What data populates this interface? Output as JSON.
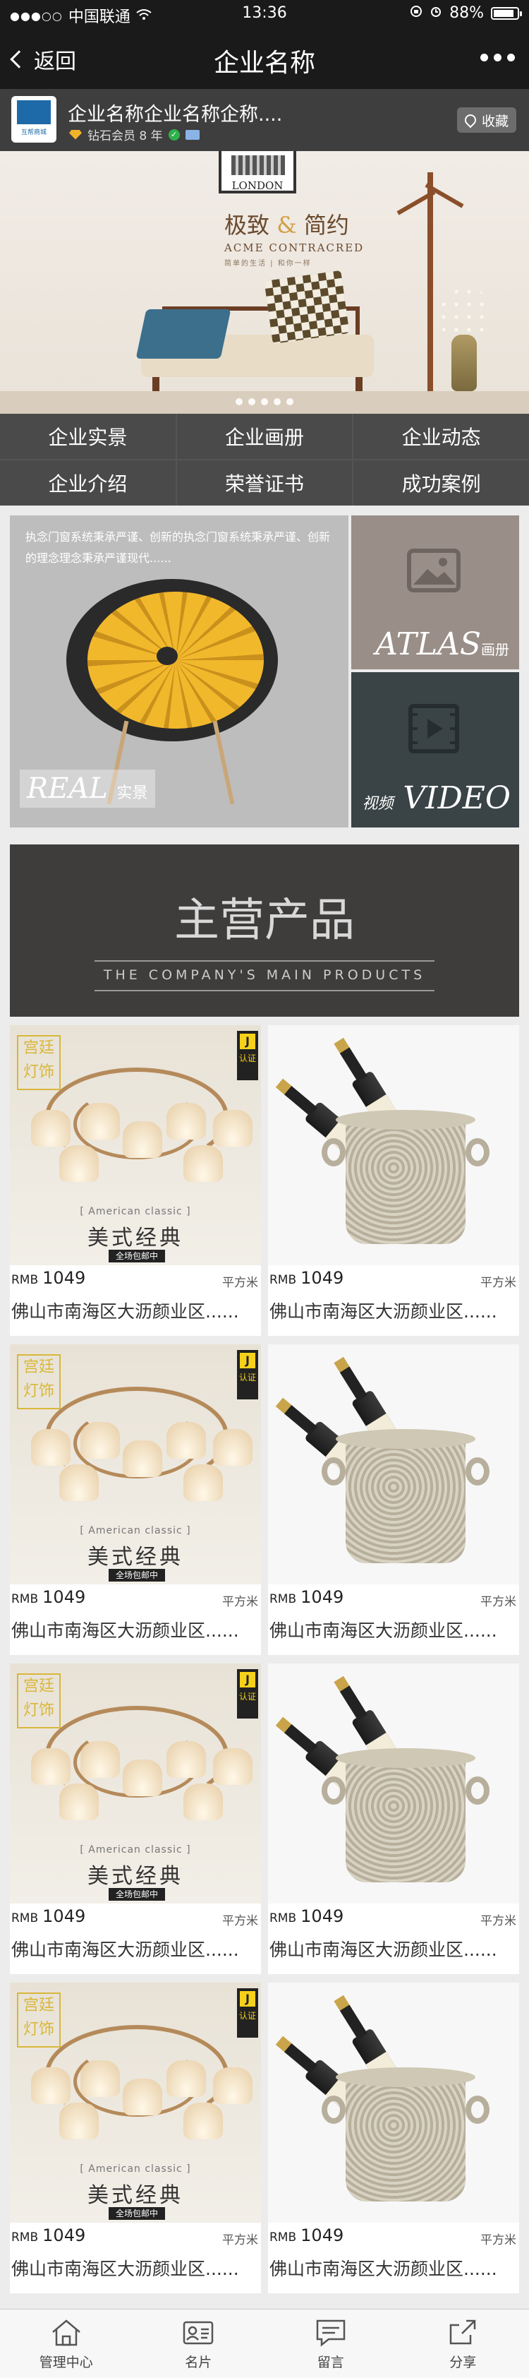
{
  "status_bar": {
    "carrier": "中国联通",
    "time": "13:36",
    "battery": "88%",
    "battery_level": 0.88
  },
  "nav": {
    "back_label": "返回",
    "title": "企业名称"
  },
  "company": {
    "name": "企业名称企业名称企称....",
    "member_level": "钻石会员 8 年",
    "favorite_label": "收藏",
    "logo_text": "互帮商城"
  },
  "banner": {
    "frame_text": "LONDON",
    "headline_part1": "极致",
    "headline_amp": "&",
    "headline_part2": "简约",
    "subline": "ACME CONTRACRED",
    "tagline": "简单的生活 | 和你一样",
    "slide_count": 5
  },
  "menu": {
    "items": [
      "企业实景",
      "企业画册",
      "企业动态",
      "企业介绍",
      "荣誉证书",
      "成功案例"
    ]
  },
  "features": {
    "real_text": "执念门窗系统秉承严谨、创新的执念门窗系统秉承严谨、创新的理念理念秉承严谨现代......",
    "real_label_en": "REAL",
    "real_label_cn": "实景",
    "atlas_label_en": "ATLAS",
    "atlas_label_cn": "画册",
    "video_label_cn": "视频",
    "video_label_en": "VIDEO"
  },
  "main_products": {
    "title": "主营产品",
    "subtitle": "THE COMPANY'S MAIN PRODUCTS"
  },
  "lamp_ad": {
    "tag": "宫廷灯饰",
    "logo": "认证",
    "logo_letter": "J",
    "en": "[ American classic ]",
    "cn": "美式经典",
    "free_ship": "全场包邮中"
  },
  "products": [
    {
      "currency": "RMB",
      "price": "1049",
      "unit": "平方米",
      "address": "佛山市南海区大沥颜业区......",
      "image": "lamp"
    },
    {
      "currency": "RMB",
      "price": "1049",
      "unit": "平方米",
      "address": "佛山市南海区大沥颜业区......",
      "image": "wine-bucket"
    },
    {
      "currency": "RMB",
      "price": "1049",
      "unit": "平方米",
      "address": "佛山市南海区大沥颜业区......",
      "image": "lamp"
    },
    {
      "currency": "RMB",
      "price": "1049",
      "unit": "平方米",
      "address": "佛山市南海区大沥颜业区......",
      "image": "wine-bucket"
    },
    {
      "currency": "RMB",
      "price": "1049",
      "unit": "平方米",
      "address": "佛山市南海区大沥颜业区......",
      "image": "lamp"
    },
    {
      "currency": "RMB",
      "price": "1049",
      "unit": "平方米",
      "address": "佛山市南海区大沥颜业区......",
      "image": "wine-bucket"
    },
    {
      "currency": "RMB",
      "price": "1049",
      "unit": "平方米",
      "address": "佛山市南海区大沥颜业区......",
      "image": "lamp"
    },
    {
      "currency": "RMB",
      "price": "1049",
      "unit": "平方米",
      "address": "佛山市南海区大沥颜业区......",
      "image": "wine-bucket"
    }
  ],
  "tabbar": {
    "items": [
      {
        "label": "管理中心",
        "icon": "home-icon"
      },
      {
        "label": "名片",
        "icon": "card-icon"
      },
      {
        "label": "留言",
        "icon": "message-icon"
      },
      {
        "label": "分享",
        "icon": "share-icon"
      }
    ]
  }
}
